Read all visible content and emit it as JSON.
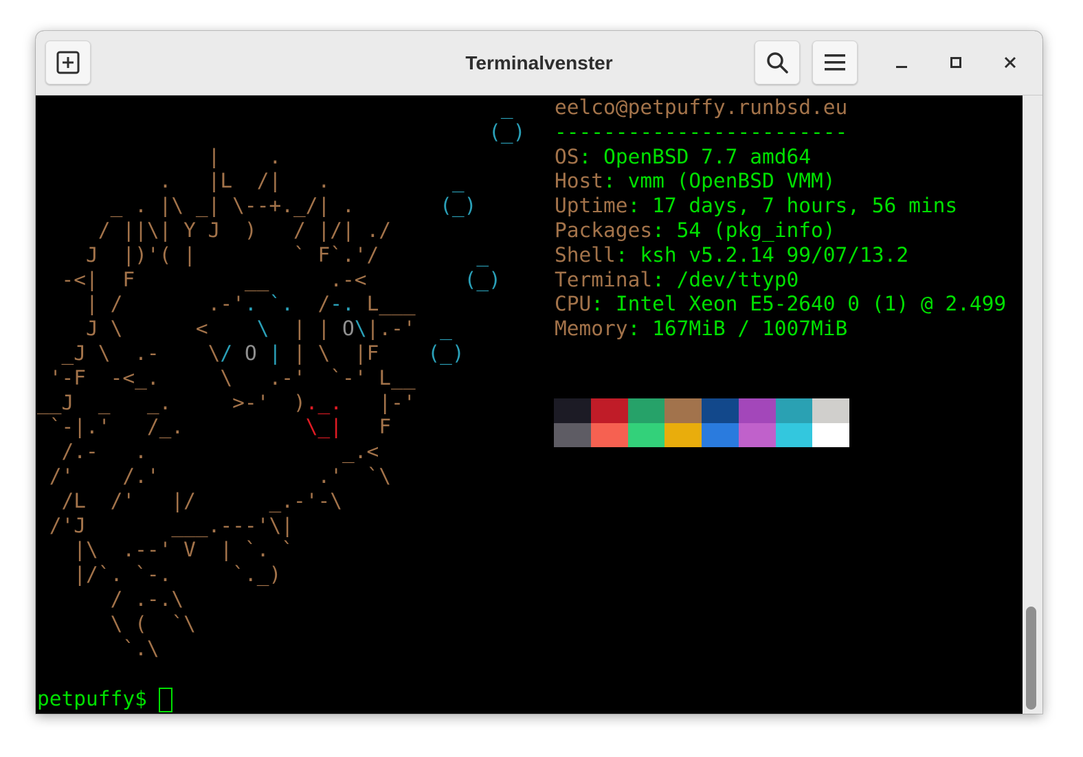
{
  "window": {
    "title": "Terminalvenster"
  },
  "icons": {
    "new_tab": "new-tab-icon",
    "search": "search-icon",
    "menu": "hamburger-menu-icon",
    "minimize": "minimize-icon",
    "maximize": "maximize-icon",
    "close": "close-icon"
  },
  "colors": {
    "ascii_brown": "#a3734a",
    "ascii_cyan": "#2aa0b8",
    "text_green": "#00e000",
    "titlebar_bg": "#ebebeb"
  },
  "sysinfo": {
    "user_host": "eelco@petpuffy.runbsd.eu",
    "separator": "------------------------",
    "lines": [
      {
        "label": "OS",
        "value": "OpenBSD 7.7 amd64"
      },
      {
        "label": "Host",
        "value": "vmm (OpenBSD VMM)"
      },
      {
        "label": "Uptime",
        "value": "17 days, 7 hours, 56 mins"
      },
      {
        "label": "Packages",
        "value": "54 (pkg_info)"
      },
      {
        "label": "Shell",
        "value": "ksh v5.2.14 99/07/13.2"
      },
      {
        "label": "Terminal",
        "value": "/dev/ttyp0"
      },
      {
        "label": "CPU",
        "value": "Intel Xeon E5-2640 0 (1) @ 2.499"
      },
      {
        "label": "Memory",
        "value": "167MiB / 1007MiB"
      }
    ]
  },
  "palette": [
    "#1c1b25",
    "#c01c28",
    "#26a269",
    "#a2734c",
    "#12488b",
    "#a347ba",
    "#2aa1b3",
    "#d0cfcc",
    "#5e5c64",
    "#f66151",
    "#33d17a",
    "#e9ad0c",
    "#2a7bde",
    "#c061cb",
    "#33c7de",
    "#ffffff"
  ],
  "prompt": {
    "text": "petpuffy$ "
  }
}
